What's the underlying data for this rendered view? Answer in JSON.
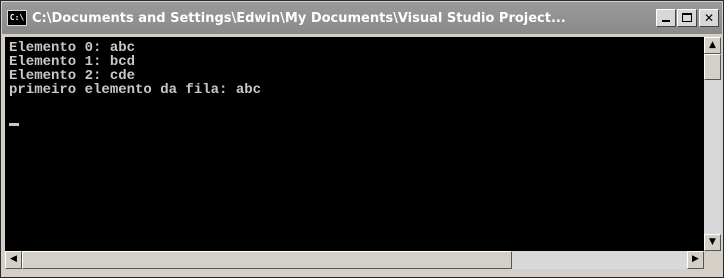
{
  "window": {
    "title": "C:\\Documents and Settings\\Edwin\\My Documents\\Visual Studio Project...",
    "icon": "console-icon",
    "buttons": {
      "minimize": "minimize-icon",
      "maximize": "maximize-icon",
      "close": "✕"
    }
  },
  "console": {
    "lines": [
      "Elemento 0: abc",
      "Elemento 1: bcd",
      "Elemento 2: cde",
      "primeiro elemento da fila: abc"
    ],
    "text_color": "#c8c8c8",
    "background": "#000000"
  },
  "scrollbars": {
    "up": "▲",
    "down": "▼",
    "left": "◀",
    "right": "▶"
  }
}
